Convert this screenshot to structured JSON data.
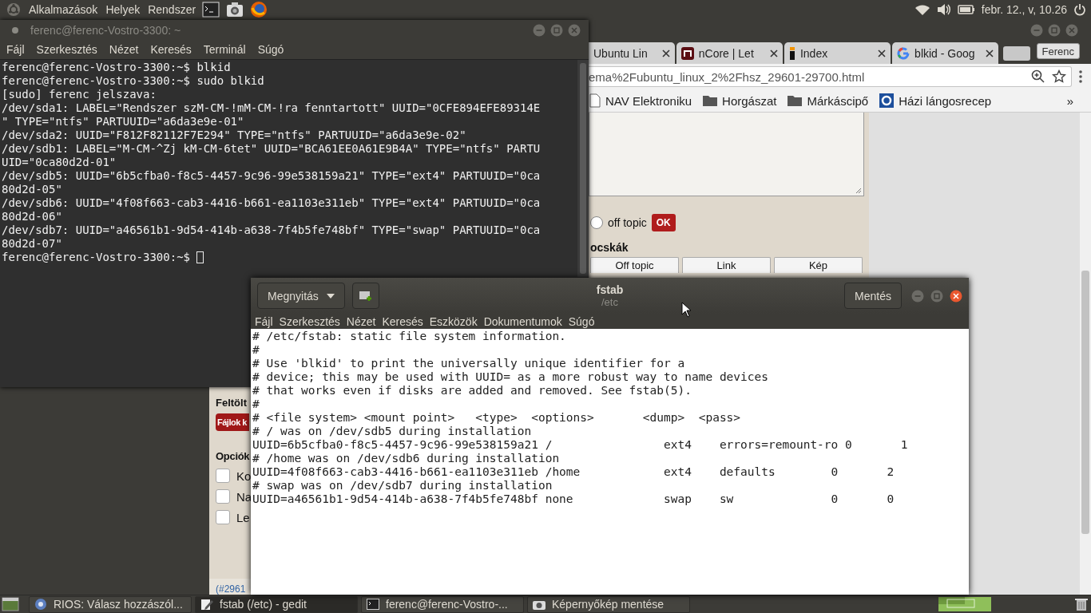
{
  "top_panel": {
    "menus": [
      "Alkalmazások",
      "Helyek",
      "Rendszer"
    ],
    "clock": "febr. 12., v, 10.26"
  },
  "browser": {
    "tabs": [
      {
        "label": "Ubuntu Lin",
        "kind": "plain",
        "selected": false
      },
      {
        "label": "nCore | Let",
        "kind": "ncore",
        "selected": false
      },
      {
        "label": "Index",
        "kind": "index",
        "selected": false
      },
      {
        "label": "blkid - Goog",
        "kind": "google",
        "selected": false
      }
    ],
    "profile": "Ferenc",
    "url": "ema%2Fubuntu_linux_2%2Fhsz_29601-29700.html",
    "bookmarks": [
      {
        "label": "NAV Elektroniku",
        "kind": "page"
      },
      {
        "label": "Horgászat",
        "kind": "folder"
      },
      {
        "label": "Márkáscipő",
        "kind": "folder"
      },
      {
        "label": "Házi lángosrecep",
        "kind": "site"
      }
    ],
    "more": "»",
    "upload_heading": "Feltölt",
    "upload_button": "Fájlok k",
    "options_heading": "Opciók",
    "options": [
      {
        "label": "Ko",
        "checked": false
      },
      {
        "label": "Na",
        "checked": false
      },
      {
        "label": "Le",
        "checked": false
      }
    ],
    "footer_link": "(#2961",
    "radio": {
      "label": "off topic",
      "checked": false
    },
    "ok_button": "OK",
    "heading": "ocskák",
    "buttons": [
      "Off topic",
      "Link",
      "Kép"
    ]
  },
  "terminal": {
    "title": "ferenc@ferenc-Vostro-3300: ~",
    "menus": [
      "Fájl",
      "Szerkesztés",
      "Nézet",
      "Keresés",
      "Terminál",
      "Súgó"
    ],
    "lines": [
      "ferenc@ferenc-Vostro-3300:~$ blkid",
      "ferenc@ferenc-Vostro-3300:~$ sudo blkid",
      "[sudo] ferenc jelszava:",
      "/dev/sda1: LABEL=\"Rendszer szM-CM-!mM-CM-!ra fenntartott\" UUID=\"0CFE894EFE89314E",
      "\" TYPE=\"ntfs\" PARTUUID=\"a6da3e9e-01\"",
      "/dev/sda2: UUID=\"F812F82112F7E294\" TYPE=\"ntfs\" PARTUUID=\"a6da3e9e-02\"",
      "/dev/sdb1: LABEL=\"M-CM-^Zj kM-CM-6tet\" UUID=\"BCA61EE0A61E9B4A\" TYPE=\"ntfs\" PARTU",
      "UID=\"0ca80d2d-01\"",
      "/dev/sdb5: UUID=\"6b5cfba0-f8c5-4457-9c96-99e538159a21\" TYPE=\"ext4\" PARTUUID=\"0ca",
      "80d2d-05\"",
      "/dev/sdb6: UUID=\"4f08f663-cab3-4416-b661-ea1103e311eb\" TYPE=\"ext4\" PARTUUID=\"0ca",
      "80d2d-06\"",
      "/dev/sdb7: UUID=\"a46561b1-9d54-414b-a638-7f4b5fe748bf\" TYPE=\"swap\" PARTUUID=\"0ca",
      "80d2d-07\""
    ],
    "prompt": "ferenc@ferenc-Vostro-3300:~$"
  },
  "editor": {
    "open_button": "Megnyitás",
    "title": "fstab",
    "subtitle": "/etc",
    "save_button": "Mentés",
    "menus": [
      "Fájl",
      "Szerkesztés",
      "Nézet",
      "Keresés",
      "Eszközök",
      "Dokumentumok",
      "Súgó"
    ],
    "lines": [
      "# /etc/fstab: static file system information.",
      "#",
      "# Use 'blkid' to print the universally unique identifier for a",
      "# device; this may be used with UUID= as a more robust way to name devices",
      "# that works even if disks are added and removed. See fstab(5).",
      "#",
      "# <file system> <mount point>   <type>  <options>       <dump>  <pass>",
      "# / was on /dev/sdb5 during installation",
      "UUID=6b5cfba0-f8c5-4457-9c96-99e538159a21 /                ext4    errors=remount-ro 0       1",
      "# /home was on /dev/sdb6 during installation",
      "UUID=4f08f663-cab3-4416-b661-ea1103e311eb /home            ext4    defaults        0       2",
      "# swap was on /dev/sdb7 during installation",
      "UUID=a46561b1-9d54-414b-a638-7f4b5fe748bf none             swap    sw              0       0"
    ]
  },
  "taskbar": {
    "items": [
      {
        "label": "RIOS: Válasz hozzászól...",
        "kind": "browser",
        "selected": false
      },
      {
        "label": "fstab (/etc) - gedit",
        "kind": "editor",
        "selected": true
      },
      {
        "label": "ferenc@ferenc-Vostro-...",
        "kind": "terminal",
        "selected": false
      },
      {
        "label": "Képernyőkép mentése",
        "kind": "camera",
        "selected": false
      }
    ]
  }
}
